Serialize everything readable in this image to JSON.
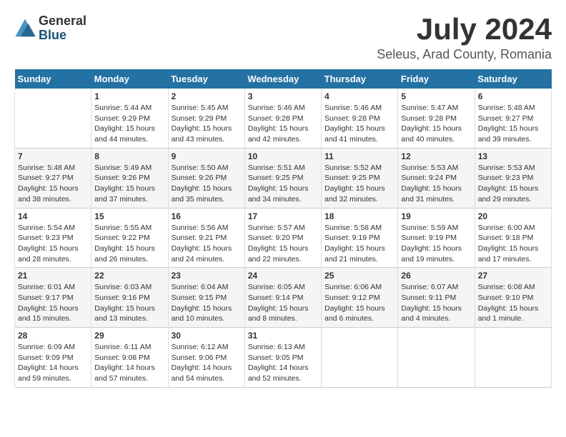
{
  "header": {
    "logo_general": "General",
    "logo_blue": "Blue",
    "month_year": "July 2024",
    "location": "Seleus, Arad County, Romania"
  },
  "weekdays": [
    "Sunday",
    "Monday",
    "Tuesday",
    "Wednesday",
    "Thursday",
    "Friday",
    "Saturday"
  ],
  "weeks": [
    [
      {
        "day": "",
        "empty": true
      },
      {
        "day": "1",
        "sunrise": "Sunrise: 5:44 AM",
        "sunset": "Sunset: 9:29 PM",
        "daylight": "Daylight: 15 hours and 44 minutes."
      },
      {
        "day": "2",
        "sunrise": "Sunrise: 5:45 AM",
        "sunset": "Sunset: 9:29 PM",
        "daylight": "Daylight: 15 hours and 43 minutes."
      },
      {
        "day": "3",
        "sunrise": "Sunrise: 5:46 AM",
        "sunset": "Sunset: 9:28 PM",
        "daylight": "Daylight: 15 hours and 42 minutes."
      },
      {
        "day": "4",
        "sunrise": "Sunrise: 5:46 AM",
        "sunset": "Sunset: 9:28 PM",
        "daylight": "Daylight: 15 hours and 41 minutes."
      },
      {
        "day": "5",
        "sunrise": "Sunrise: 5:47 AM",
        "sunset": "Sunset: 9:28 PM",
        "daylight": "Daylight: 15 hours and 40 minutes."
      },
      {
        "day": "6",
        "sunrise": "Sunrise: 5:48 AM",
        "sunset": "Sunset: 9:27 PM",
        "daylight": "Daylight: 15 hours and 39 minutes."
      }
    ],
    [
      {
        "day": "7",
        "sunrise": "Sunrise: 5:48 AM",
        "sunset": "Sunset: 9:27 PM",
        "daylight": "Daylight: 15 hours and 38 minutes."
      },
      {
        "day": "8",
        "sunrise": "Sunrise: 5:49 AM",
        "sunset": "Sunset: 9:26 PM",
        "daylight": "Daylight: 15 hours and 37 minutes."
      },
      {
        "day": "9",
        "sunrise": "Sunrise: 5:50 AM",
        "sunset": "Sunset: 9:26 PM",
        "daylight": "Daylight: 15 hours and 35 minutes."
      },
      {
        "day": "10",
        "sunrise": "Sunrise: 5:51 AM",
        "sunset": "Sunset: 9:25 PM",
        "daylight": "Daylight: 15 hours and 34 minutes."
      },
      {
        "day": "11",
        "sunrise": "Sunrise: 5:52 AM",
        "sunset": "Sunset: 9:25 PM",
        "daylight": "Daylight: 15 hours and 32 minutes."
      },
      {
        "day": "12",
        "sunrise": "Sunrise: 5:53 AM",
        "sunset": "Sunset: 9:24 PM",
        "daylight": "Daylight: 15 hours and 31 minutes."
      },
      {
        "day": "13",
        "sunrise": "Sunrise: 5:53 AM",
        "sunset": "Sunset: 9:23 PM",
        "daylight": "Daylight: 15 hours and 29 minutes."
      }
    ],
    [
      {
        "day": "14",
        "sunrise": "Sunrise: 5:54 AM",
        "sunset": "Sunset: 9:23 PM",
        "daylight": "Daylight: 15 hours and 28 minutes."
      },
      {
        "day": "15",
        "sunrise": "Sunrise: 5:55 AM",
        "sunset": "Sunset: 9:22 PM",
        "daylight": "Daylight: 15 hours and 26 minutes."
      },
      {
        "day": "16",
        "sunrise": "Sunrise: 5:56 AM",
        "sunset": "Sunset: 9:21 PM",
        "daylight": "Daylight: 15 hours and 24 minutes."
      },
      {
        "day": "17",
        "sunrise": "Sunrise: 5:57 AM",
        "sunset": "Sunset: 9:20 PM",
        "daylight": "Daylight: 15 hours and 22 minutes."
      },
      {
        "day": "18",
        "sunrise": "Sunrise: 5:58 AM",
        "sunset": "Sunset: 9:19 PM",
        "daylight": "Daylight: 15 hours and 21 minutes."
      },
      {
        "day": "19",
        "sunrise": "Sunrise: 5:59 AM",
        "sunset": "Sunset: 9:19 PM",
        "daylight": "Daylight: 15 hours and 19 minutes."
      },
      {
        "day": "20",
        "sunrise": "Sunrise: 6:00 AM",
        "sunset": "Sunset: 9:18 PM",
        "daylight": "Daylight: 15 hours and 17 minutes."
      }
    ],
    [
      {
        "day": "21",
        "sunrise": "Sunrise: 6:01 AM",
        "sunset": "Sunset: 9:17 PM",
        "daylight": "Daylight: 15 hours and 15 minutes."
      },
      {
        "day": "22",
        "sunrise": "Sunrise: 6:03 AM",
        "sunset": "Sunset: 9:16 PM",
        "daylight": "Daylight: 15 hours and 13 minutes."
      },
      {
        "day": "23",
        "sunrise": "Sunrise: 6:04 AM",
        "sunset": "Sunset: 9:15 PM",
        "daylight": "Daylight: 15 hours and 10 minutes."
      },
      {
        "day": "24",
        "sunrise": "Sunrise: 6:05 AM",
        "sunset": "Sunset: 9:14 PM",
        "daylight": "Daylight: 15 hours and 8 minutes."
      },
      {
        "day": "25",
        "sunrise": "Sunrise: 6:06 AM",
        "sunset": "Sunset: 9:12 PM",
        "daylight": "Daylight: 15 hours and 6 minutes."
      },
      {
        "day": "26",
        "sunrise": "Sunrise: 6:07 AM",
        "sunset": "Sunset: 9:11 PM",
        "daylight": "Daylight: 15 hours and 4 minutes."
      },
      {
        "day": "27",
        "sunrise": "Sunrise: 6:08 AM",
        "sunset": "Sunset: 9:10 PM",
        "daylight": "Daylight: 15 hours and 1 minute."
      }
    ],
    [
      {
        "day": "28",
        "sunrise": "Sunrise: 6:09 AM",
        "sunset": "Sunset: 9:09 PM",
        "daylight": "Daylight: 14 hours and 59 minutes."
      },
      {
        "day": "29",
        "sunrise": "Sunrise: 6:11 AM",
        "sunset": "Sunset: 9:08 PM",
        "daylight": "Daylight: 14 hours and 57 minutes."
      },
      {
        "day": "30",
        "sunrise": "Sunrise: 6:12 AM",
        "sunset": "Sunset: 9:06 PM",
        "daylight": "Daylight: 14 hours and 54 minutes."
      },
      {
        "day": "31",
        "sunrise": "Sunrise: 6:13 AM",
        "sunset": "Sunset: 9:05 PM",
        "daylight": "Daylight: 14 hours and 52 minutes."
      },
      {
        "day": "",
        "empty": true
      },
      {
        "day": "",
        "empty": true
      },
      {
        "day": "",
        "empty": true
      }
    ]
  ]
}
